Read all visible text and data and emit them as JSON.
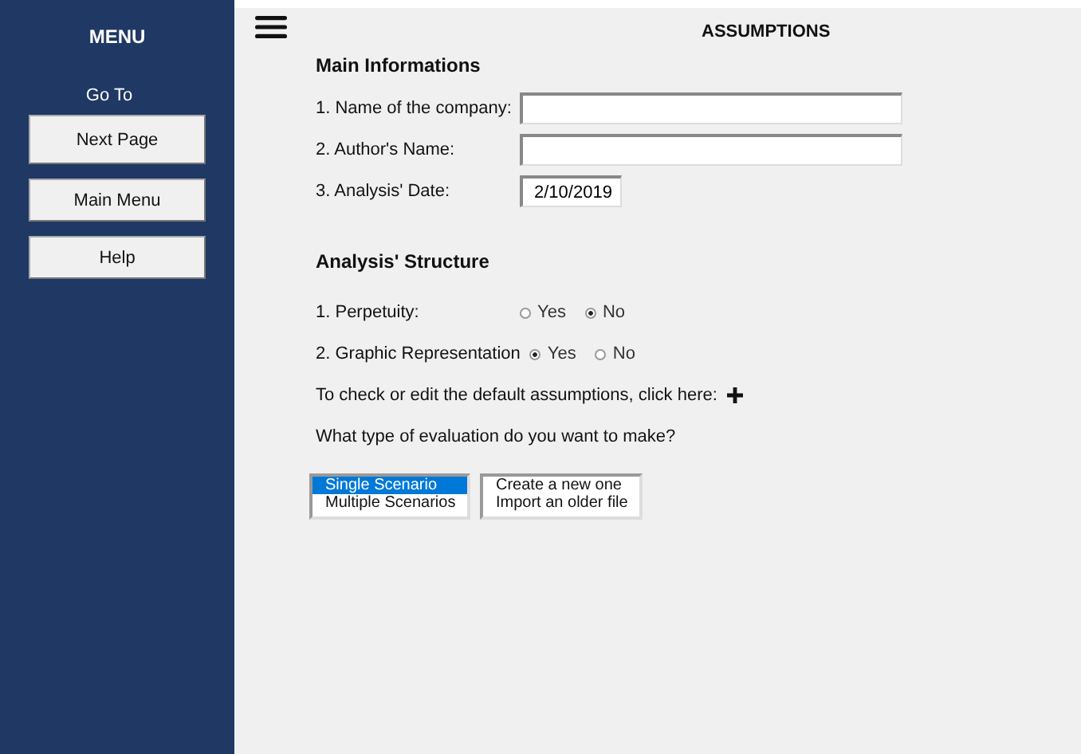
{
  "sidebar": {
    "title": "MENU",
    "goto_label": "Go To",
    "buttons": [
      "Next Page",
      "Main Menu",
      "Help"
    ]
  },
  "page_title": "ASSUMPTIONS",
  "main_info": {
    "heading": "Main Informations",
    "fields": [
      {
        "label": "1. Name of the company:",
        "kind": "wide"
      },
      {
        "label": "2. Author's Name:",
        "kind": "wide"
      },
      {
        "label": "3. Analysis' Date:",
        "value": "2/10/2019",
        "kind": "short"
      }
    ]
  },
  "structure": {
    "heading": "Analysis' Structure",
    "questions": [
      {
        "label": "1. Perpetuity:",
        "options": [
          {
            "label": "Yes",
            "selected": false
          },
          {
            "label": "No",
            "selected": true
          }
        ]
      },
      {
        "label": "2. Graphic Representation",
        "options": [
          {
            "label": "Yes",
            "selected": true
          },
          {
            "label": "No",
            "selected": false
          }
        ]
      }
    ],
    "defaults_text": "To check or edit the default assumptions, click here:",
    "evaluation_question": "What type of evaluation do you want to make?",
    "lists": [
      [
        {
          "label": "Single Scenario",
          "selected": true
        },
        {
          "label": "Multiple Scenarios",
          "selected": false
        }
      ],
      [
        {
          "label": "Create a new one",
          "selected": false
        },
        {
          "label": "Import an older file",
          "selected": false
        }
      ]
    ]
  }
}
